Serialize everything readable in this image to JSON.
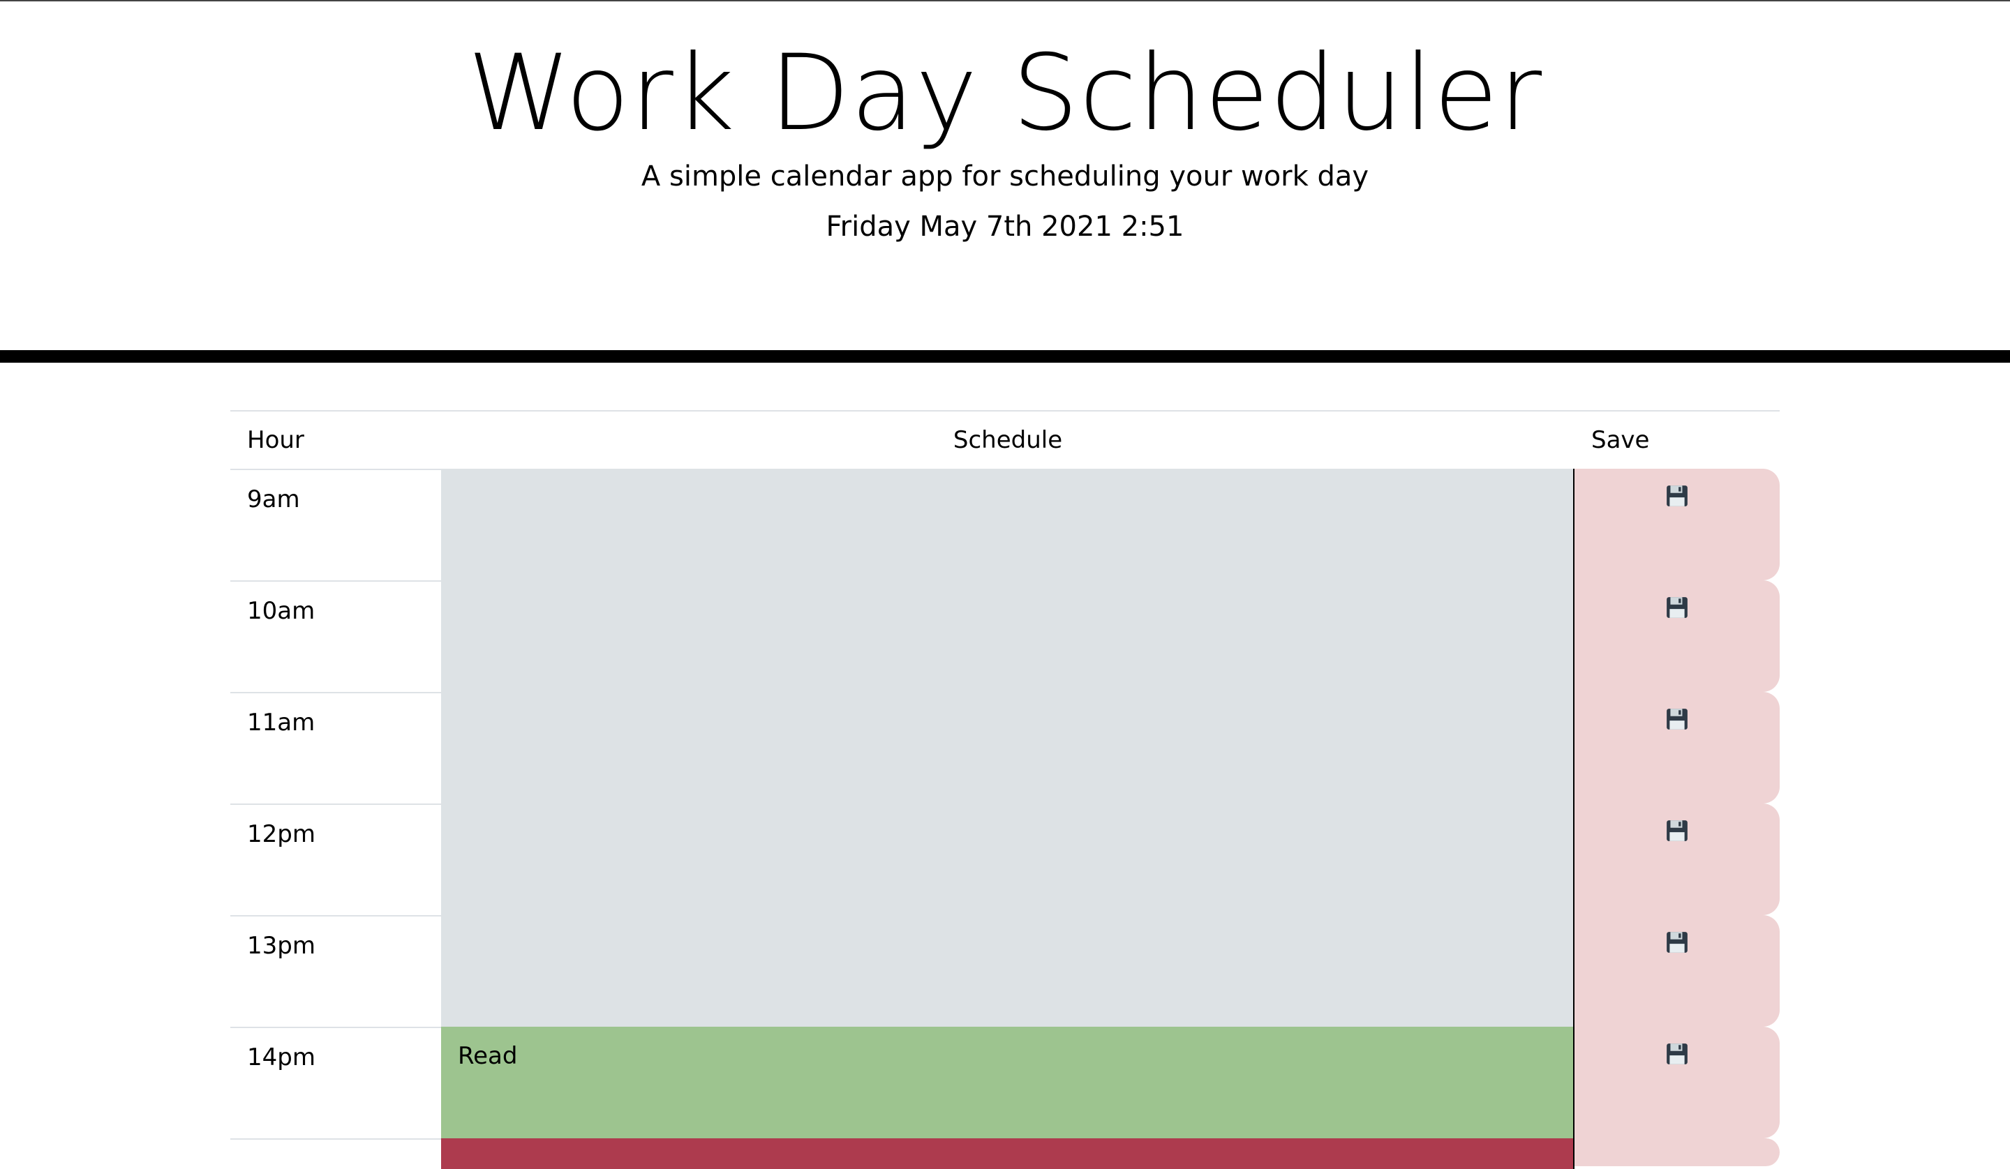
{
  "header": {
    "title": "Work Day Scheduler",
    "subtitle": "A simple calendar app for scheduling your work day",
    "current_day": "Friday May 7th 2021 2:51"
  },
  "table": {
    "headers": {
      "hour": "Hour",
      "schedule": "Schedule",
      "save": "Save"
    },
    "rows": [
      {
        "hour": "9am",
        "text": "",
        "state": "past"
      },
      {
        "hour": "10am",
        "text": "",
        "state": "past"
      },
      {
        "hour": "11am",
        "text": "",
        "state": "past"
      },
      {
        "hour": "12pm",
        "text": "",
        "state": "past"
      },
      {
        "hour": "13pm",
        "text": "",
        "state": "past"
      },
      {
        "hour": "14pm",
        "text": "Read",
        "state": "present"
      }
    ]
  },
  "icons": {
    "save": "floppy-disk-icon"
  },
  "colors": {
    "past": "#dde2e5",
    "present": "#9dc48f",
    "future": "#ad3b4e",
    "save_button": "#efd3d4"
  }
}
